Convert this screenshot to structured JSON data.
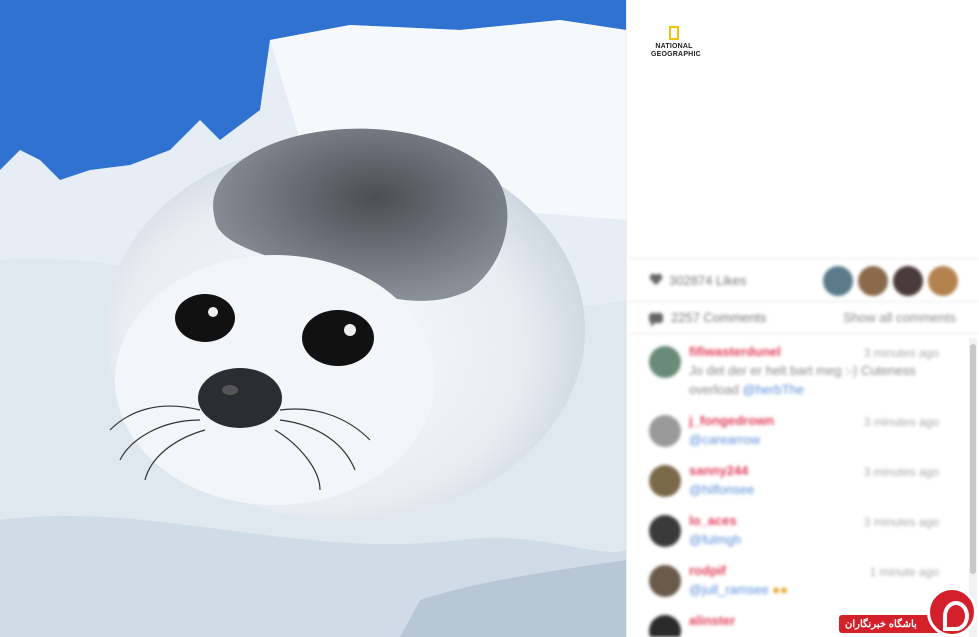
{
  "photo": {
    "alt": "Harp seal pup on snow",
    "sky_color": "#2f79d8",
    "snow_color": "#e6edf4"
  },
  "brand": {
    "logo_line1": "NATIONAL",
    "logo_line2": "GEOGRAPHIC",
    "logo_color": "#f4c400"
  },
  "stats": {
    "likes": "302874 Likes",
    "comments": "2257 Comments",
    "show_all": "Show all comments"
  },
  "comments": [
    {
      "user": "fifiwasterdunel",
      "time": "3 minutes ago",
      "text": "Jo det der er helt bart meg :-) Cuteness overload",
      "mention": "@herbThe"
    },
    {
      "user": "j_fongedrown",
      "time": "3 minutes ago",
      "text": "",
      "mention": "@carearrow"
    },
    {
      "user": "sanny244",
      "time": "3 minutes ago",
      "text": "",
      "mention": "@hilfonsee"
    },
    {
      "user": "lo_aces",
      "time": "3 minutes ago",
      "text": "",
      "mention": "@fulmgh"
    },
    {
      "user": "rodpif",
      "time": "1 minute ago",
      "text": "",
      "mention": "@jull_ramsee"
    },
    {
      "user": "alinster",
      "time": "",
      "text": "",
      "mention": ""
    }
  ],
  "watermark": {
    "text": "باشگاه خبرنگاران",
    "color": "#d3202a"
  }
}
